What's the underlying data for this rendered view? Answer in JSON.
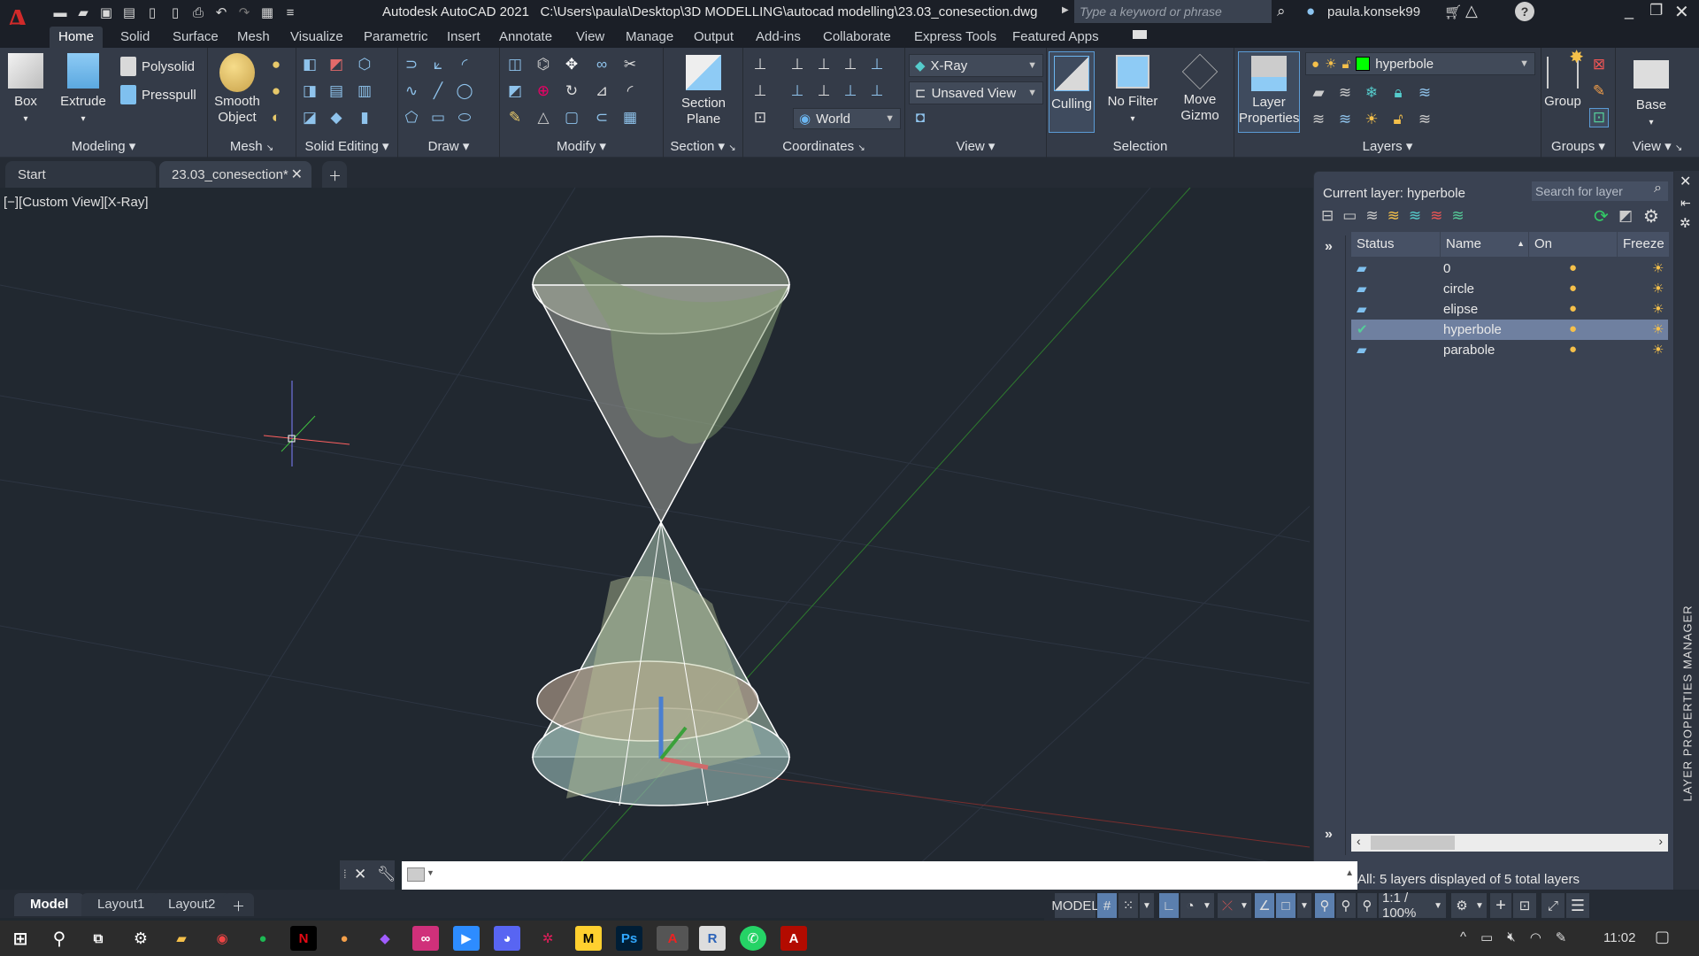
{
  "app": {
    "title": "Autodesk AutoCAD 2021",
    "file_path": "C:\\Users\\paula\\Desktop\\3D MODELLING\\autocad modelling\\23.03_conesection.dwg",
    "search_placeholder": "Type a keyword or phrase",
    "user": "paula.konsek99",
    "logo": "A"
  },
  "quick_access": [
    "new-icon",
    "open-icon",
    "save-icon",
    "save-as-icon",
    "open-from-web-icon",
    "save-to-web-icon",
    "plot-icon",
    "undo-icon",
    "redo-icon",
    "workspace-icon",
    "customize-icon"
  ],
  "ribbon_tabs": [
    "Home",
    "Solid",
    "Surface",
    "Mesh",
    "Visualize",
    "Parametric",
    "Insert",
    "Annotate",
    "View",
    "Manage",
    "Output",
    "Add-ins",
    "Collaborate",
    "Express Tools",
    "Featured Apps"
  ],
  "ribbon": {
    "modeling": {
      "title": "Modeling",
      "box": "Box",
      "extrude": "Extrude",
      "polysolid": "Polysolid",
      "presspull": "Presspull"
    },
    "mesh": {
      "title": "Mesh",
      "smooth_object": "Smooth Object"
    },
    "solid_editing": {
      "title": "Solid Editing"
    },
    "draw": {
      "title": "Draw"
    },
    "modify": {
      "title": "Modify"
    },
    "section": {
      "title": "Section",
      "section_plane": "Section Plane"
    },
    "coordinates": {
      "title": "Coordinates",
      "ucs": "World"
    },
    "view": {
      "title": "View",
      "visual_style": "X-Ray",
      "named_view": "Unsaved View"
    },
    "selection": {
      "title": "Selection",
      "culling": "Culling",
      "no_filter": "No Filter",
      "move_gizmo": "Move Gizmo"
    },
    "layers": {
      "title": "Layers",
      "layer_properties": "Layer Properties",
      "current_layer": "hyperbole",
      "layer_color": "#00ff00"
    },
    "groups": {
      "title": "Groups",
      "group": "Group"
    },
    "view2": {
      "title": "View",
      "base": "Base"
    }
  },
  "doc_tabs": [
    {
      "label": "Start"
    },
    {
      "label": "23.03_conesection*",
      "active": true
    }
  ],
  "viewport": {
    "label": "[−][Custom View][X-Ray]"
  },
  "layer_manager": {
    "current_layer_label": "Current layer: hyperbole",
    "search_placeholder": "Search for layer",
    "columns": [
      "Status",
      "Name",
      "On",
      "Freeze"
    ],
    "rows": [
      {
        "status": "layer",
        "name": "0",
        "on": true,
        "freeze": false
      },
      {
        "status": "layer",
        "name": "circle",
        "on": true,
        "freeze": false
      },
      {
        "status": "layer",
        "name": "elipse",
        "on": true,
        "freeze": false
      },
      {
        "status": "current",
        "name": "hyperbole",
        "on": true,
        "freeze": false,
        "selected": true
      },
      {
        "status": "layer",
        "name": "parabole",
        "on": true,
        "freeze": false
      }
    ],
    "footer": "All: 5 layers displayed of 5 total layers",
    "side_title": "LAYER PROPERTIES MANAGER"
  },
  "command_line": {
    "value": ""
  },
  "layout_tabs": [
    "Model",
    "Layout1",
    "Layout2"
  ],
  "status_bar": {
    "model": "MODEL",
    "scale": "1:1 / 100%"
  },
  "taskbar": {
    "apps": [
      "windows",
      "search",
      "task-view",
      "settings",
      "file-explorer",
      "chrome",
      "spotify",
      "netflix",
      "app-orange",
      "app-drop",
      "creative-cloud",
      "zoom",
      "discord",
      "slack",
      "miro",
      "photoshop",
      "autocad",
      "revit",
      "whatsapp",
      "acrobat"
    ],
    "clock": "11:02"
  }
}
